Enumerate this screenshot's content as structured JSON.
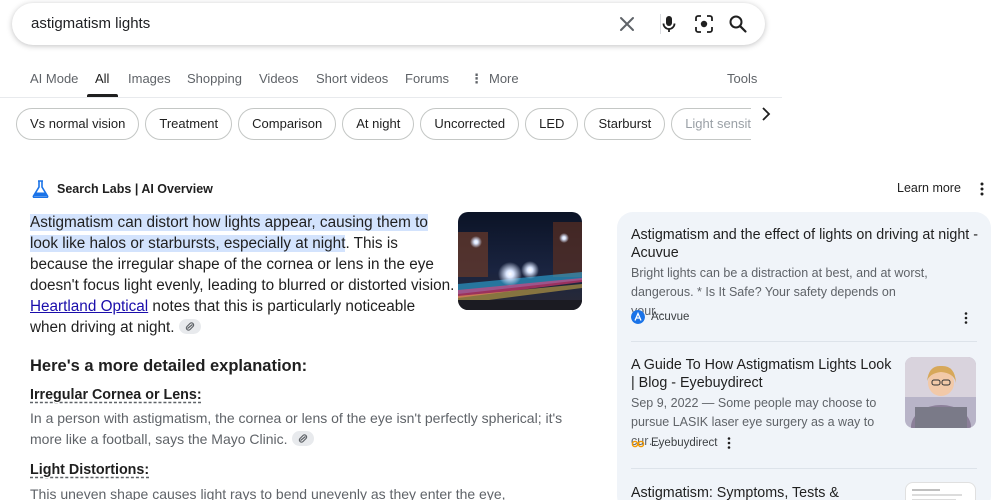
{
  "search": {
    "query": "astigmatism lights"
  },
  "tabs": [
    {
      "label": "AI Mode"
    },
    {
      "label": "All"
    },
    {
      "label": "Images"
    },
    {
      "label": "Shopping"
    },
    {
      "label": "Videos"
    },
    {
      "label": "Short videos"
    },
    {
      "label": "Forums"
    },
    {
      "label": "More"
    }
  ],
  "tools_label": "Tools",
  "chips": [
    "Vs normal vision",
    "Treatment",
    "Comparison",
    "At night",
    "Uncorrected",
    "LED",
    "Starburst",
    "Light sensitivity"
  ],
  "ai_overview": {
    "header": "Search Labs | AI Overview",
    "learn_more": "Learn more",
    "highlight": "Astigmatism can distort how lights appear, causing them to look like halos or starbursts, especially at night",
    "para_rest": ". This is because the irregular shape of the cornea or lens in the eye doesn't focus light evenly, leading to blurred or distorted vi­sion. ",
    "link": "Heartland Optical",
    "para_tail": " notes that this is particularly no­ticeable when driving at night.",
    "detail_heading": "Here's a more detailed explanation:",
    "sections": [
      {
        "title": "Irregular Cornea or Lens:",
        "text": "In a person with astigmatism, the cornea or lens of the eye isn't perfectly spherical; it's more like a football, says the Mayo Clinic."
      },
      {
        "title": "Light Distortions:",
        "text": "This uneven shape causes light rays to bend unevenly as they enter the eye,"
      }
    ]
  },
  "sources": [
    {
      "title": "Astigmatism and the effect of lights on driving at night - Acuvue",
      "snippet": "Bright lights can be a distraction at best, and at worst, dangerous. * Is It Safe? Your safety depends on your…",
      "source": "Acuvue"
    },
    {
      "title": "A Guide To How Astigmatism Lights Look | Blog - Eyebuydirect",
      "snippet": "Sep 9, 2022 — Some people may choose to pursue LASIK laser eye surgery as a way to cur…",
      "source": "Eyebuydirect"
    },
    {
      "title": "Astigmatism: Symptoms, Tests &"
    }
  ],
  "colors": {
    "highlight": "#d3e3fd",
    "link": "#1a0dab",
    "panel": "#f0f4f9"
  }
}
